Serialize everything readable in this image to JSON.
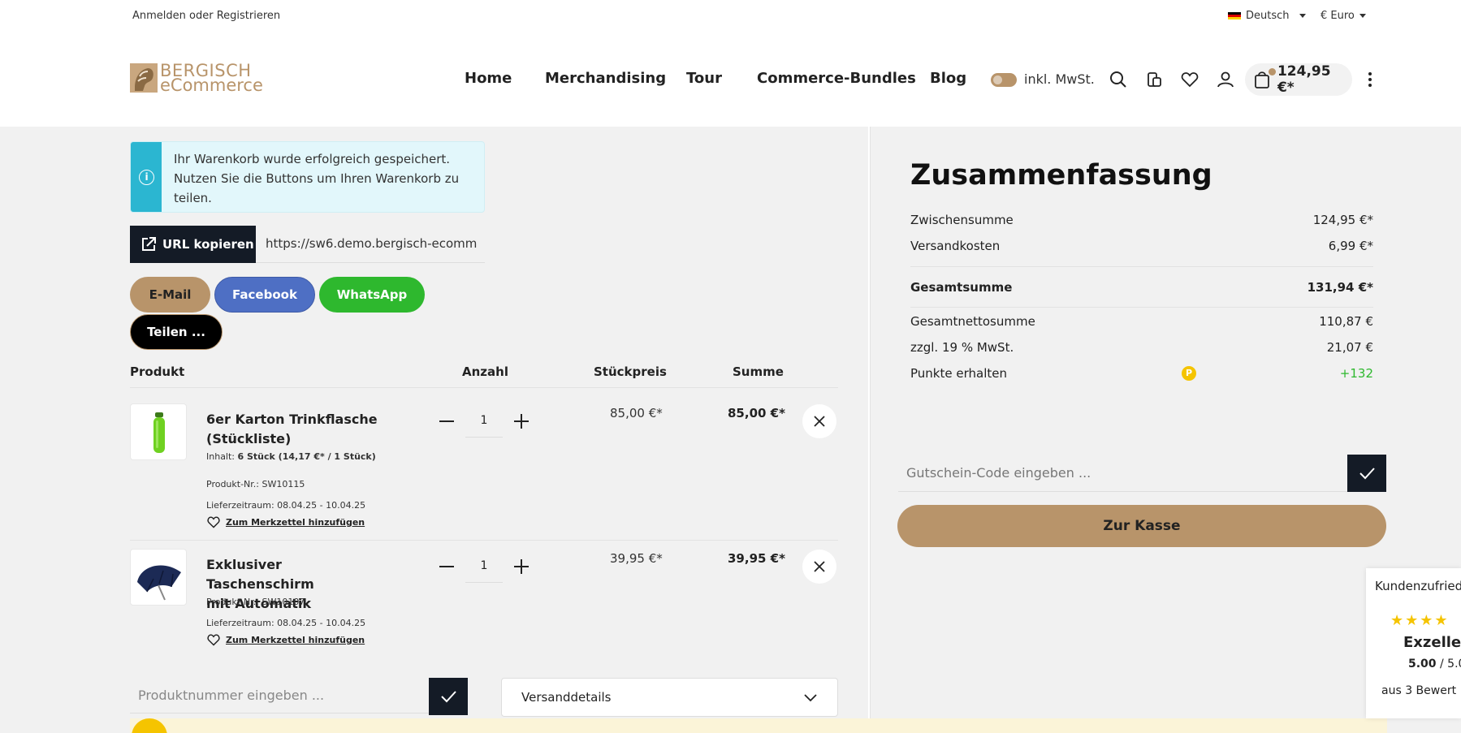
{
  "topbar": {
    "login": "Anmelden oder Registrieren",
    "language": "Deutsch",
    "currency": "€ Euro"
  },
  "header": {
    "logo_line1": "BERGISCH",
    "logo_line2": "eCommerce",
    "nav": [
      "Home",
      "Merchandising",
      "Tour",
      "Commerce-Bundles",
      "Blog"
    ],
    "tax_toggle_label": "inkl. MwSt.",
    "cart_total": "124,95 €*"
  },
  "notice": {
    "text": "Ihr Warenkorb wurde erfolgreich gespeichert. Nutzen Sie die Buttons um Ihren Warenkorb zu teilen."
  },
  "share": {
    "url_button": "URL kopieren",
    "url_value": "https://sw6.demo.bergisch-ecomm",
    "email": "E-Mail",
    "facebook": "Facebook",
    "whatsapp": "WhatsApp",
    "teilen": "Teilen ..."
  },
  "table": {
    "headers": {
      "product": "Produkt",
      "qty": "Anzahl",
      "unit_price": "Stückpreis",
      "sum": "Summe"
    }
  },
  "items": [
    {
      "name_line1": "6er Karton Trinkflasche",
      "name_line2": "(Stückliste)",
      "content_label": "Inhalt:",
      "content_value": "6 Stück (14,17 €* / 1 Stück)",
      "sku": "Produkt-Nr.: SW10115",
      "delivery": "Lieferzeitraum: 08.04.25 - 10.04.25",
      "wishlist": "Zum Merkzettel hinzufügen",
      "qty": "1",
      "unit_price": "85,00 €*",
      "sum": "85,00 €*"
    },
    {
      "name_line1": "Exklusiver Taschenschirm",
      "name_line2": "mit Automatik",
      "sku": "Produkt-Nr.: SW10107",
      "delivery": "Lieferzeitraum: 08.04.25 - 10.04.25",
      "wishlist": "Zum Merkzettel hinzufügen",
      "qty": "1",
      "unit_price": "39,95 €*",
      "sum": "39,95 €*"
    }
  ],
  "product_number_placeholder": "Produktnummer eingeben ...",
  "shipping_details": "Versanddetails",
  "summary": {
    "title": "Zusammenfassung",
    "subtotal_label": "Zwischensumme",
    "subtotal": "124,95 €*",
    "shipping_label": "Versandkosten",
    "shipping": "6,99 €*",
    "total_label": "Gesamtsumme",
    "total": "131,94 €*",
    "net_label": "Gesamtnettosumme",
    "net": "110,87 €",
    "vat_label": "zzgl. 19 % MwSt.",
    "vat": "21,07 €",
    "points_label": "Punkte erhalten",
    "points_badge": "P",
    "points": "+132",
    "coupon_placeholder": "Gutschein-Code eingeben ...",
    "checkout": "Zur Kasse"
  },
  "widget": {
    "title": "Kundenzufried",
    "stars": "★★★★",
    "rating_word": "Exzellen",
    "score": "5.00",
    "score_max": " / 5.0",
    "reviews": "aus 3 Bewert"
  },
  "colors": {
    "accent": "#b8946a",
    "dark": "#141b26",
    "info": "#2bb6d1",
    "facebook": "#4e6fc4",
    "whatsapp": "#2eb82e",
    "points_green": "#2eb82e"
  }
}
